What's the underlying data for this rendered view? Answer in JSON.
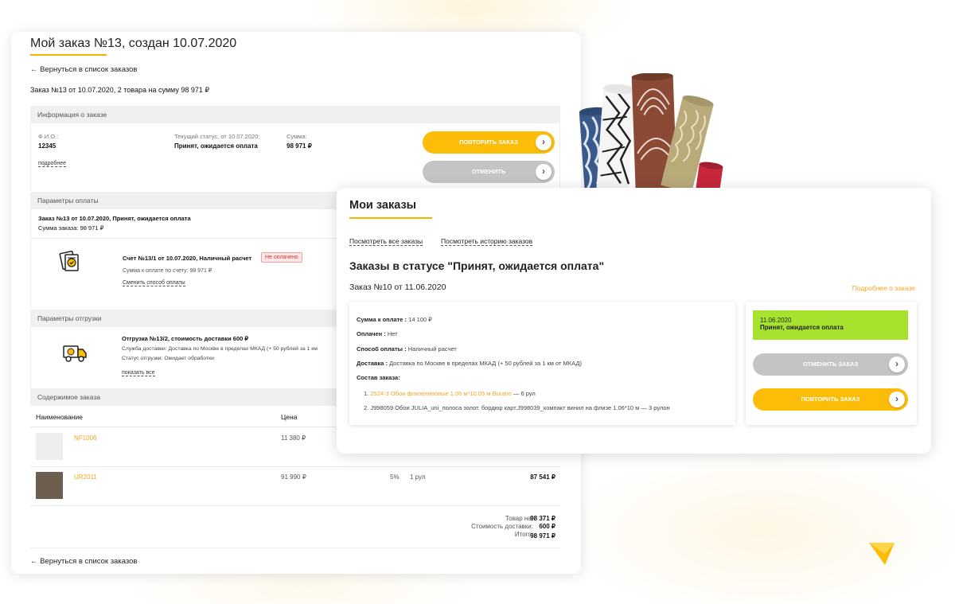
{
  "left_card": {
    "title": "Мой заказ №13, создан 10.07.2020",
    "back_link": "← Вернуться в список заказов",
    "summary": "Заказ №13 от 10.07.2020, 2 товара на сумму 98 971 ₽",
    "info": {
      "section_title": "Информация о заказе",
      "fio_label": "Ф.И.О.:",
      "fio_value": "12345",
      "status_label": "Текущий статус, от 10.07.2020:",
      "status_value": "Принят, ожидается оплата",
      "sum_label": "Сумма:",
      "sum_value": "98 971 ₽",
      "details_link": "подробнее",
      "repeat_button": "Повторить заказ",
      "cancel_button": "Отменить"
    },
    "payment": {
      "section_title": "Параметры оплаты",
      "order_line": "Заказ №13 от 10.07.2020, Принят, ожидается оплата",
      "order_sum": "Сумма заказа: 98 971 ₽",
      "invoice_title": "Счет №13/1 от 10.07.2020, Наличный расчет",
      "invoice_badge": "Не оплачено",
      "invoice_sum": "Сумма к оплате по счету: 98 971 ₽",
      "change_link": "Сменить способ оплаты"
    },
    "shipping": {
      "section_title": "Параметры отгрузки",
      "title": "Отгрузка №13/2, стоимость доставки 600 ₽",
      "service": "Служба доставки: Доставка по Москве в пределах МКАД (+ 50 рублей за 1 км",
      "status": "Статус отгрузки: Ожидает обработки",
      "show_all": "показать все"
    },
    "contents": {
      "section_title": "Содержимое заказа",
      "col_name": "Наименование",
      "col_price": "Цена",
      "rows": [
        {
          "name": "NF1006",
          "price": "11 380 ₽",
          "discount": "",
          "qty": "",
          "total": ""
        },
        {
          "name": "UR2011",
          "price": "91 990 ₽",
          "discount": "5%",
          "qty": "1 рул",
          "total": "87 541 ₽"
        }
      ],
      "goods_label": "Товар на:",
      "goods_value": "98 371 ₽",
      "delivery_label": "Стоимость доставки:",
      "delivery_value": "600 ₽",
      "total_label": "Итого:",
      "total_value": "98 971 ₽"
    }
  },
  "right_card": {
    "title": "Мои заказы",
    "link_all": "Посмотреть все заказы",
    "link_history": "Посмотреть историю заказов",
    "heading": "Заказы в статусе \"Принят, ожидается оплата\"",
    "order_title": "Заказ №10 от 11.06.2020",
    "more_link": "Подробнее о заказе",
    "sum_label": "Сумма к оплате :",
    "sum_value": " 14 100 ₽",
    "paid_label": "Оплачен :",
    "paid_value": " Нет",
    "pay_method_label": "Способ оплаты :",
    "pay_method_value": " Наличный расчет",
    "delivery_label": "Доставка :",
    "delivery_value": " Доставка по Москве в пределах МКАД (+ 50 рублей за 1 км от МКАД)",
    "composition_label": "Состав заказа:",
    "items": [
      {
        "num": "1.",
        "name": "2524-3 Обои флизелиновые 1,06 м*10,05 м Burano",
        "qty": "— 6 рул"
      },
      {
        "num": "2.",
        "name": "J998059 Обои JULIA_uni_полоса золот. бордюр карт.J998039_компакт винил на флизе 1.06*10 м",
        "qty": "— 3 рулон"
      }
    ],
    "status_date": "11.06.2020",
    "status_text": "Принят, ожидается оплата",
    "cancel_button": "Отменить заказ",
    "repeat_button": "Повторить заказ"
  },
  "colors": {
    "accent": "#fbbd08",
    "link_orange": "#f5a623",
    "status_green": "#a6e22e",
    "button_gray": "#c4c4c4",
    "unpaid_red": "#d9302e"
  }
}
